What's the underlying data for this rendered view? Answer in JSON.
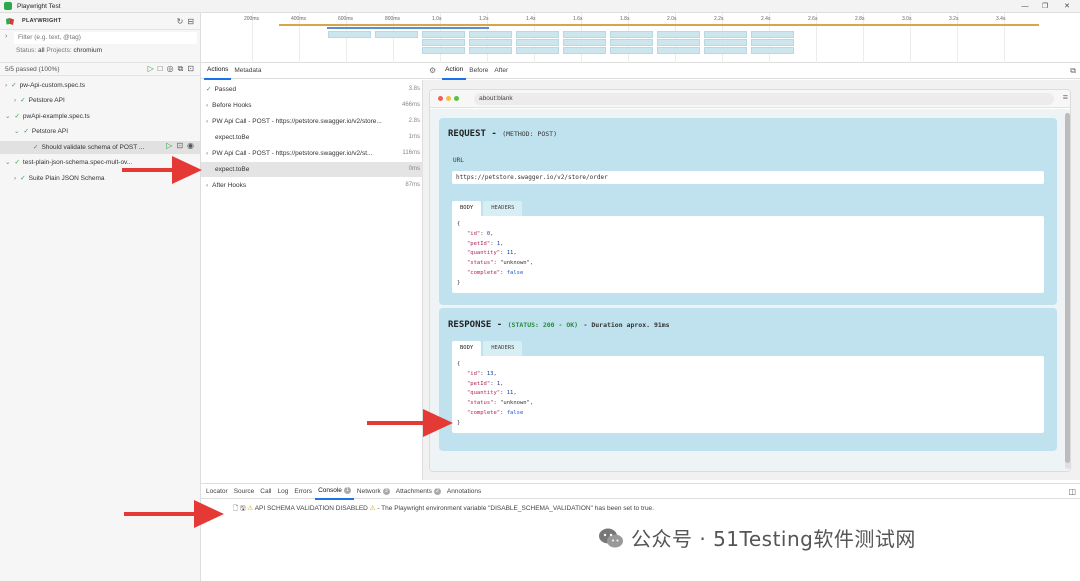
{
  "window": {
    "title": "Playwright Test",
    "minimize": "—",
    "maximize": "❐",
    "close": "✕"
  },
  "sidebar": {
    "brand": "PLAYWRIGHT",
    "filter_placeholder": "Filter (e.g. text, @tag)",
    "status_label": "Status:",
    "status_value": "all",
    "projects_label": "Projects:",
    "projects_value": "chromium",
    "passed_summary": "5/5 passed (100%)",
    "tree": [
      {
        "label": "pw-Api-custom.spec.ts"
      },
      {
        "label": "Petstore API"
      },
      {
        "label": "pwApi-example.spec.ts"
      },
      {
        "label": "Petstore API"
      },
      {
        "label": "Should validate schema of POST ..."
      },
      {
        "label": "test-plain-json-schema.spec-mult-ov..."
      },
      {
        "label": "Suite Plain JSON Schema"
      }
    ]
  },
  "timeline": {
    "ticks": [
      "200ms",
      "400ms",
      "600ms",
      "800ms",
      "1.0s",
      "1.2s",
      "1.4s",
      "1.6s",
      "1.8s",
      "2.0s",
      "2.2s",
      "2.4s",
      "2.6s",
      "2.8s",
      "3.0s",
      "3.2s",
      "3.4s"
    ]
  },
  "middle": {
    "tabs": [
      "Actions",
      "Metadata"
    ],
    "actions": [
      {
        "label": "Passed",
        "dur": "3.8s"
      },
      {
        "label": "Before Hooks",
        "dur": "466ms"
      },
      {
        "label": "PW Api Call - POST - https://petstore.swagger.io/v2/store...",
        "dur": "2.8s"
      },
      {
        "label": "expect.toBe",
        "dur": "1ms"
      },
      {
        "label": "PW Api Call - POST - https://petstore.swagger.io/v2/st...",
        "dur": "116ms"
      },
      {
        "label": "expect.toBe",
        "dur": "0ms"
      },
      {
        "label": "After Hooks",
        "dur": "87ms"
      }
    ]
  },
  "snapshot": {
    "tabs": [
      "Action",
      "Before",
      "After"
    ],
    "url": "about:blank",
    "request": {
      "title": "REQUEST",
      "dash": "-",
      "method": "(METHOD: POST)",
      "url_label": "URL",
      "url": "https://petstore.swagger.io/v2/store/order",
      "tabs": [
        "BODY",
        "HEADERS"
      ],
      "body": [
        {
          "key": "\"id\"",
          "val": "0",
          "type": "n",
          "comma": ","
        },
        {
          "key": "\"petId\"",
          "val": "1",
          "type": "n",
          "comma": ","
        },
        {
          "key": "\"quantity\"",
          "val": "11",
          "type": "n",
          "comma": ","
        },
        {
          "key": "\"status\"",
          "val": "\"unknown\"",
          "type": "s",
          "comma": ","
        },
        {
          "key": "\"complete\"",
          "val": "false",
          "type": "b",
          "comma": ""
        }
      ]
    },
    "response": {
      "title": "RESPONSE",
      "dash": "-",
      "status": "(STATUS: 200 - OK)",
      "duration": "- Duration aprox. 91ms",
      "tabs": [
        "BODY",
        "HEADERS"
      ],
      "body": [
        {
          "key": "\"id\"",
          "val": "13",
          "type": "n",
          "comma": ","
        },
        {
          "key": "\"petId\"",
          "val": "1",
          "type": "n",
          "comma": ","
        },
        {
          "key": "\"quantity\"",
          "val": "11",
          "type": "n",
          "comma": ","
        },
        {
          "key": "\"status\"",
          "val": "\"unknown\"",
          "type": "s",
          "comma": ","
        },
        {
          "key": "\"complete\"",
          "val": "false",
          "type": "b",
          "comma": ""
        }
      ]
    }
  },
  "console": {
    "tabs": [
      {
        "label": "Locator"
      },
      {
        "label": "Source"
      },
      {
        "label": "Call"
      },
      {
        "label": "Log"
      },
      {
        "label": "Errors"
      },
      {
        "label": "Console",
        "badge": "1"
      },
      {
        "label": "Network",
        "badge": "3"
      },
      {
        "label": "Attachments",
        "badge": "2"
      },
      {
        "label": "Annotations"
      }
    ],
    "message_main": "API SCHEMA VALIDATION DISABLED",
    "message_rest": "- The Playwright environment variable \"DISABLE_SCHEMA_VALIDATION\" has been set to true."
  },
  "watermark": {
    "text": "公众号 · 51Testing软件测试网"
  },
  "colors": {
    "accent": "#1a73e8",
    "pass": "#2c9b43",
    "arrow": "#e53935",
    "panel": "#bfe2ee"
  }
}
